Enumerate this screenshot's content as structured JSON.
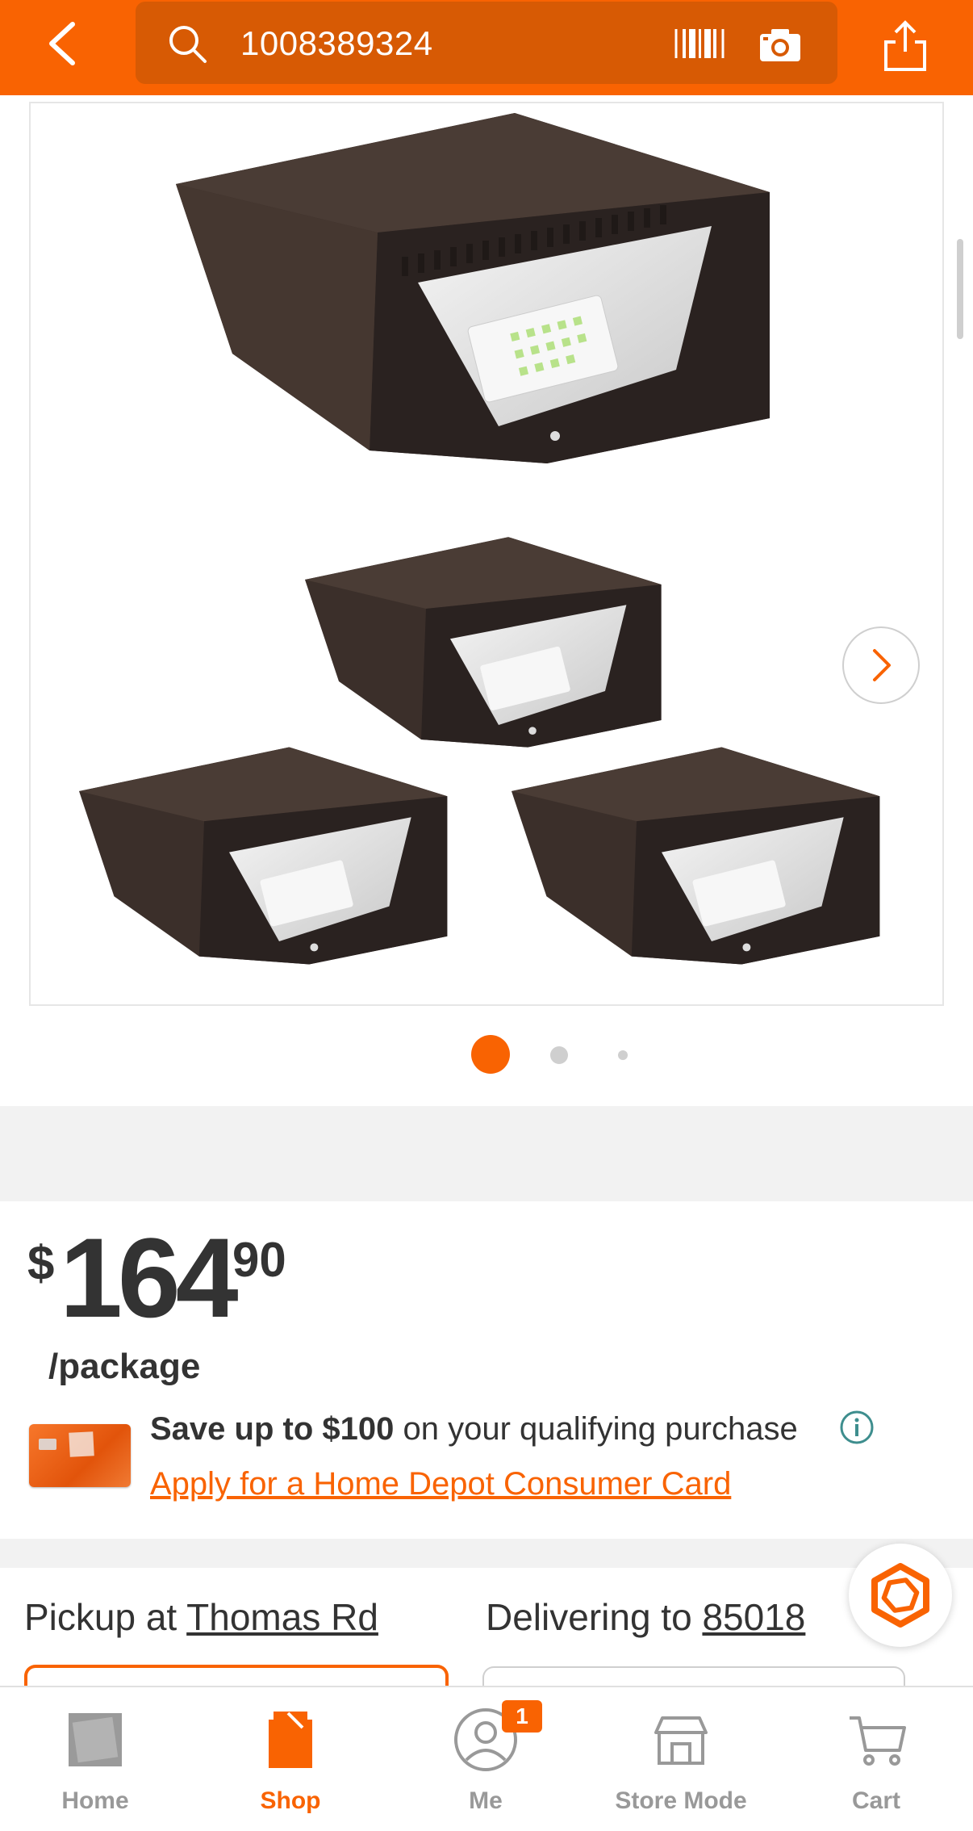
{
  "header": {
    "search_value": "1008389324",
    "colors": {
      "bar": "#f96302",
      "search_bg": "#d75a04"
    },
    "icons": [
      "back-icon",
      "search-icon",
      "barcode-icon",
      "camera-icon",
      "share-icon"
    ]
  },
  "gallery": {
    "active_index": 1,
    "total_dots": 3,
    "icons": [
      "chevron-right-icon"
    ]
  },
  "price": {
    "dollar_sign": "$",
    "whole": "164",
    "cents": "90",
    "unit": "/package"
  },
  "promo": {
    "bold": "Save up to $100",
    "rest": " on your qualifying purchase",
    "link": "Apply for a Home Depot Consumer Card"
  },
  "fulfillment": {
    "pickup_prefix": "Pickup at ",
    "pickup_store": "Thomas Rd",
    "delivery_prefix": "Delivering to ",
    "delivery_zip": "85018"
  },
  "nav": {
    "items": [
      {
        "label": "Home",
        "icon": "home-depot-logo-icon",
        "active": false
      },
      {
        "label": "Shop",
        "icon": "shop-icon",
        "active": true
      },
      {
        "label": "Me",
        "icon": "user-icon",
        "active": false,
        "badge": "1"
      },
      {
        "label": "Store Mode",
        "icon": "store-icon",
        "active": false
      },
      {
        "label": "Cart",
        "icon": "cart-icon",
        "active": false
      }
    ]
  }
}
